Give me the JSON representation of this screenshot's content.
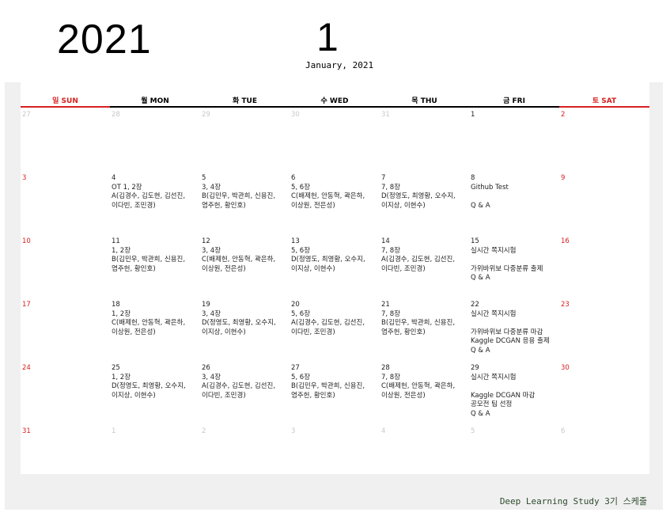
{
  "header": {
    "year": "2021",
    "month_number": "1",
    "month_caption": "January, 2021"
  },
  "weekdays": [
    {
      "label": "일 SUN",
      "kind": "sun"
    },
    {
      "label": "월 MON",
      "kind": "mon"
    },
    {
      "label": "화 TUE",
      "kind": "tue"
    },
    {
      "label": "수 WED",
      "kind": "wed"
    },
    {
      "label": "목 THU",
      "kind": "thu"
    },
    {
      "label": "금 FRI",
      "kind": "fri"
    },
    {
      "label": "토 SAT",
      "kind": "sat"
    }
  ],
  "weeks": [
    [
      {
        "day": "27",
        "style": "gray",
        "lines": []
      },
      {
        "day": "28",
        "style": "gray",
        "lines": []
      },
      {
        "day": "29",
        "style": "gray",
        "lines": []
      },
      {
        "day": "30",
        "style": "gray",
        "lines": []
      },
      {
        "day": "31",
        "style": "gray",
        "lines": []
      },
      {
        "day": "1",
        "style": "normal",
        "lines": []
      },
      {
        "day": "2",
        "style": "red",
        "lines": []
      }
    ],
    [
      {
        "day": "3",
        "style": "red",
        "lines": []
      },
      {
        "day": "4",
        "style": "normal",
        "lines": [
          "OT 1, 2장",
          "A(김경수, 김도현, 김선진,",
          "이다빈, 조민경)"
        ]
      },
      {
        "day": "5",
        "style": "normal",
        "lines": [
          "3, 4장",
          "B(김민우, 박관희, 신용진,",
          "염주헌, 황인호)"
        ]
      },
      {
        "day": "6",
        "style": "normal",
        "lines": [
          "5, 6장",
          "C(배제헌, 안동혁, 곽은하,",
          "이상원, 전은성)"
        ]
      },
      {
        "day": "7",
        "style": "normal",
        "lines": [
          "7, 8장",
          "D(정영도, 최영황, 오수지,",
          "이지상, 이현수)"
        ]
      },
      {
        "day": "8",
        "style": "normal",
        "lines": [
          "Github Test",
          "",
          "Q & A"
        ]
      },
      {
        "day": "9",
        "style": "red",
        "lines": []
      }
    ],
    [
      {
        "day": "10",
        "style": "red",
        "lines": []
      },
      {
        "day": "11",
        "style": "normal",
        "lines": [
          "1, 2장",
          "B(김민우, 박관희, 신용진,",
          "염주헌, 황인호)"
        ]
      },
      {
        "day": "12",
        "style": "normal",
        "lines": [
          "3, 4장",
          "C(배제헌, 안동혁, 곽은하,",
          "이상원, 전은성)"
        ]
      },
      {
        "day": "13",
        "style": "normal",
        "lines": [
          "5, 6장",
          "D(정영도, 최영황, 오수지,",
          "이지상, 이현수)"
        ]
      },
      {
        "day": "14",
        "style": "normal",
        "lines": [
          "7, 8장",
          "A(김경수, 김도현, 김선진,",
          "이다빈, 조민경)"
        ]
      },
      {
        "day": "15",
        "style": "normal",
        "lines": [
          "실시간 쪽지시험",
          "",
          "가위바위보 다중분류 출제",
          "Q & A"
        ]
      },
      {
        "day": "16",
        "style": "red",
        "lines": []
      }
    ],
    [
      {
        "day": "17",
        "style": "red",
        "lines": []
      },
      {
        "day": "18",
        "style": "normal",
        "lines": [
          "1, 2장",
          "C(배제헌, 안동혁, 곽은하,",
          "이상원, 전은성)"
        ]
      },
      {
        "day": "19",
        "style": "normal",
        "lines": [
          "3, 4장",
          "D(정영도, 최영황, 오수지,",
          "이지상, 이현수)"
        ]
      },
      {
        "day": "20",
        "style": "normal",
        "lines": [
          "5, 6장",
          "A(김경수, 김도현, 김선진,",
          "이다빈, 조민경)"
        ]
      },
      {
        "day": "21",
        "style": "normal",
        "lines": [
          "7, 8장",
          "B(김민우, 박관희, 신용진,",
          "염주헌, 황인호)"
        ]
      },
      {
        "day": "22",
        "style": "normal",
        "lines": [
          "실시간 쪽지시험",
          "",
          "가위바위보 다중분류 마감",
          "Kaggle DCGAN 응용 출제",
          "Q & A"
        ]
      },
      {
        "day": "23",
        "style": "red",
        "lines": []
      }
    ],
    [
      {
        "day": "24",
        "style": "red",
        "lines": []
      },
      {
        "day": "25",
        "style": "normal",
        "lines": [
          "1, 2장",
          "D(정영도, 최영황, 오수지,",
          "이지상, 이현수)"
        ]
      },
      {
        "day": "26",
        "style": "normal",
        "lines": [
          "3, 4장",
          "A(김경수, 김도현, 김선진,",
          "이다빈, 조민경)"
        ]
      },
      {
        "day": "27",
        "style": "normal",
        "lines": [
          "5, 6장",
          "B(김민우, 박관희, 신용진,",
          "염주헌, 황인호)"
        ]
      },
      {
        "day": "28",
        "style": "normal",
        "lines": [
          "7, 8장",
          "C(배제헌, 안동혁, 곽은하,",
          "이상원, 전은성)"
        ]
      },
      {
        "day": "29",
        "style": "normal",
        "lines": [
          "실시간 쪽지시험",
          "",
          "Kaggle DCGAN 마감",
          "공모전 팀 선정",
          "Q & A"
        ]
      },
      {
        "day": "30",
        "style": "red",
        "lines": []
      }
    ],
    [
      {
        "day": "31",
        "style": "red",
        "lines": []
      },
      {
        "day": "1",
        "style": "gray",
        "lines": []
      },
      {
        "day": "2",
        "style": "gray",
        "lines": []
      },
      {
        "day": "3",
        "style": "gray",
        "lines": []
      },
      {
        "day": "4",
        "style": "gray",
        "lines": []
      },
      {
        "day": "5",
        "style": "gray",
        "lines": []
      },
      {
        "day": "6",
        "style": "gray",
        "lines": []
      }
    ]
  ],
  "footer": {
    "title": "Deep Learning Study 3기 스케줄"
  }
}
